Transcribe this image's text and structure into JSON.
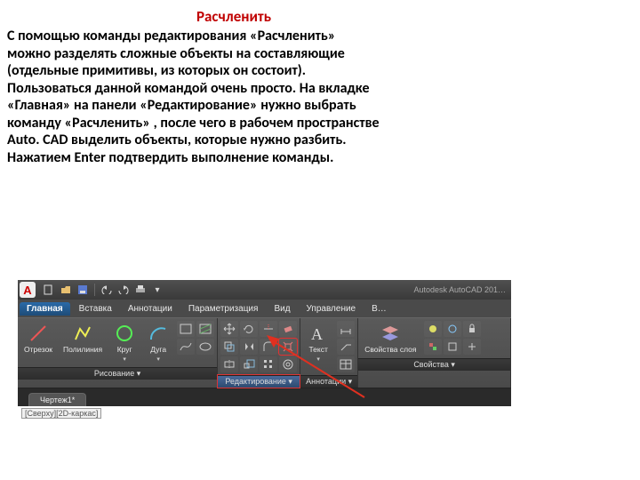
{
  "article": {
    "heading": "Расчленить",
    "body": "С помощью команды редактирования «Расчленить» можно разделять сложные объекты на составляющие (отдельные примитивы, из которых он состоит). Пользоваться данной командой очень просто. На вкладке «Главная» на панели «Редактирование» нужно выбрать команду «Расчленить» , после чего в рабочем пространстве Auto. CAD выделить объекты, которые нужно разбить. Нажатием Enter подтвердить выполнение команды."
  },
  "autocad": {
    "app_logo": "A",
    "app_title": "Autodesk AutoCAD 201…",
    "tabs": [
      "Главная",
      "Вставка",
      "Аннотации",
      "Параметризация",
      "Вид",
      "Управление",
      "В…"
    ],
    "active_tab": "Главная",
    "draw_panel": {
      "title": "Рисование",
      "buttons": [
        "Отрезок",
        "Полилиния",
        "Круг",
        "Дуга"
      ]
    },
    "modify_panel": {
      "title": "Редактирование"
    },
    "annot_panel": {
      "title": "Аннотации",
      "text_btn": "Текст"
    },
    "prop_panel": {
      "title": "Свойства",
      "prop_btn": "Свойства слоя"
    },
    "file_tab": "Чертеж1*",
    "view_label": "[Сверху][2D-каркас]"
  }
}
